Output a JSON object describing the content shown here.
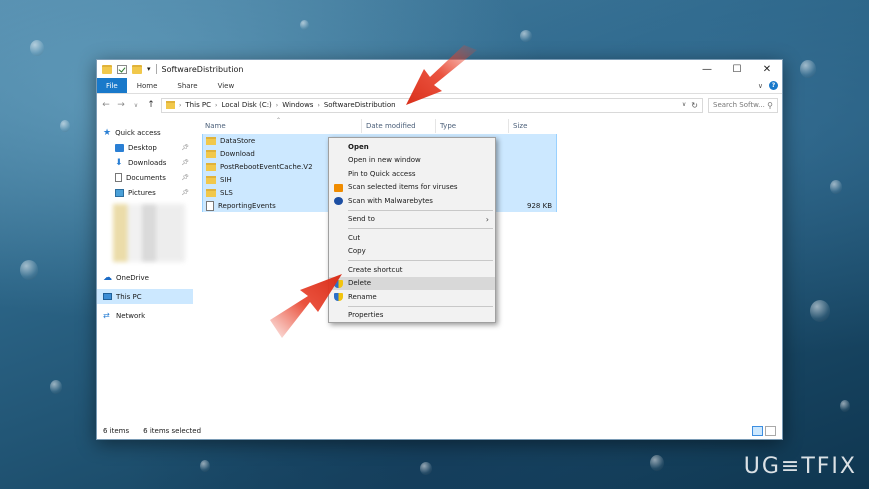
{
  "window": {
    "title": "SoftwareDistribution"
  },
  "window_controls": {
    "minimize": "—",
    "maximize": "☐",
    "close": "✕"
  },
  "ribbon": {
    "tabs": [
      "File",
      "Home",
      "Share",
      "View"
    ],
    "help": "?"
  },
  "address": {
    "back": "←",
    "forward": "→",
    "recent": "∨",
    "up": "↑",
    "crumbs": [
      "This PC",
      "Local Disk (C:)",
      "Windows",
      "SoftwareDistribution"
    ],
    "separator": "›",
    "dropdown": "∨",
    "refresh": "↻"
  },
  "search": {
    "placeholder": "Search Softw...",
    "icon": "search-icon"
  },
  "sidebar": {
    "quick_access": "Quick access",
    "items": [
      {
        "label": "Desktop",
        "icon": "desktop-icon",
        "pinned": true
      },
      {
        "label": "Downloads",
        "icon": "downloads-icon",
        "pinned": true
      },
      {
        "label": "Documents",
        "icon": "documents-icon",
        "pinned": true
      },
      {
        "label": "Pictures",
        "icon": "pictures-icon",
        "pinned": true
      }
    ],
    "onedrive": "OneDrive",
    "this_pc": "This PC",
    "network": "Network"
  },
  "columns": {
    "name": "Name",
    "date": "Date modified",
    "type": "Type",
    "size": "Size"
  },
  "files": [
    {
      "name": "DataStore",
      "kind": "folder",
      "size": ""
    },
    {
      "name": "Download",
      "kind": "folder",
      "size": ""
    },
    {
      "name": "PostRebootEventCache.V2",
      "kind": "folder",
      "size": ""
    },
    {
      "name": "SIH",
      "kind": "folder",
      "size": ""
    },
    {
      "name": "SLS",
      "kind": "folder",
      "size": ""
    },
    {
      "name": "ReportingEvents",
      "kind": "file",
      "size": "928 KB"
    }
  ],
  "context_menu": {
    "open": "Open",
    "open_new_window": "Open in new window",
    "pin_quick_access": "Pin to Quick access",
    "scan_viruses": "Scan selected items for viruses",
    "scan_malwarebytes": "Scan with Malwarebytes",
    "send_to": "Send to",
    "cut": "Cut",
    "copy": "Copy",
    "create_shortcut": "Create shortcut",
    "delete": "Delete",
    "rename": "Rename",
    "properties": "Properties"
  },
  "status": {
    "count": "6 items",
    "selected": "6 items selected"
  },
  "watermark": "UG≡TFIX",
  "colors": {
    "accent": "#1979ca",
    "selection": "#cce8ff",
    "arrow": "#e8402a"
  }
}
